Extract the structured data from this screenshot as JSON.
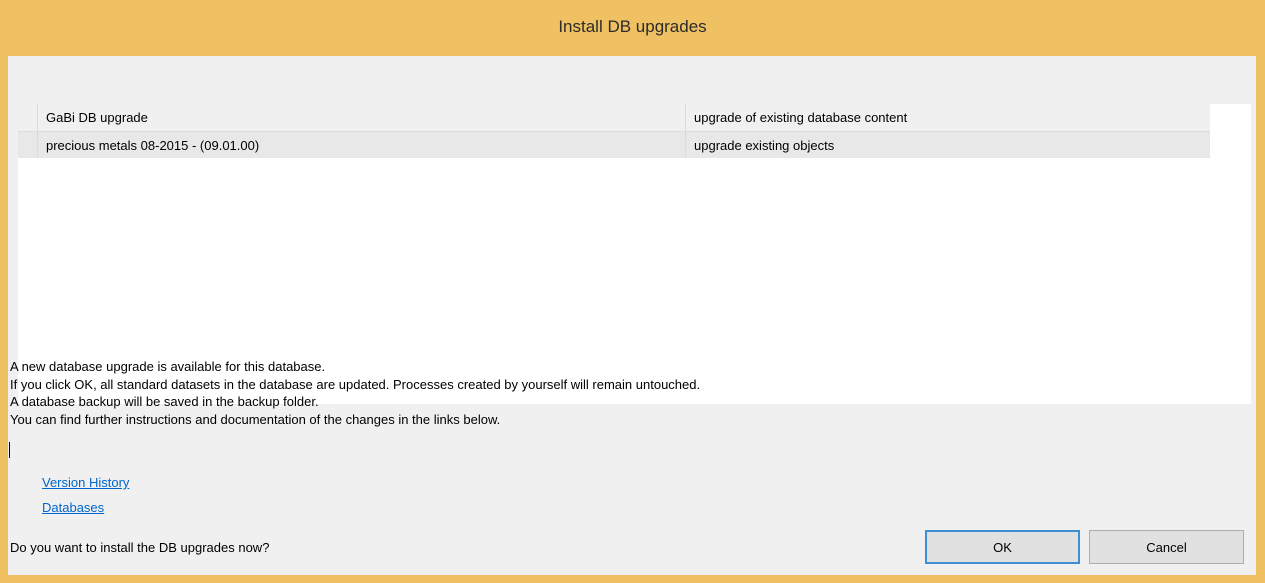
{
  "window": {
    "title": "Install DB upgrades"
  },
  "grid": {
    "columns": [
      "GaBi DB upgrade",
      "upgrade of existing database content"
    ],
    "rows": [
      [
        "precious metals 08-2015 - (09.01.00)",
        "upgrade existing objects"
      ]
    ]
  },
  "message": {
    "lines": [
      "A new database upgrade is available for this database.",
      "If you click OK, all standard datasets in the database are updated. Processes created by yourself will remain untouched.",
      "A database backup will be saved in the backup folder.",
      "You can find further instructions and documentation of the changes in the links below."
    ]
  },
  "links": {
    "version_history": "Version History",
    "databases": "Databases"
  },
  "footer": {
    "question": "Do you want to install the DB upgrades now?",
    "ok_label": "OK",
    "cancel_label": "Cancel"
  }
}
